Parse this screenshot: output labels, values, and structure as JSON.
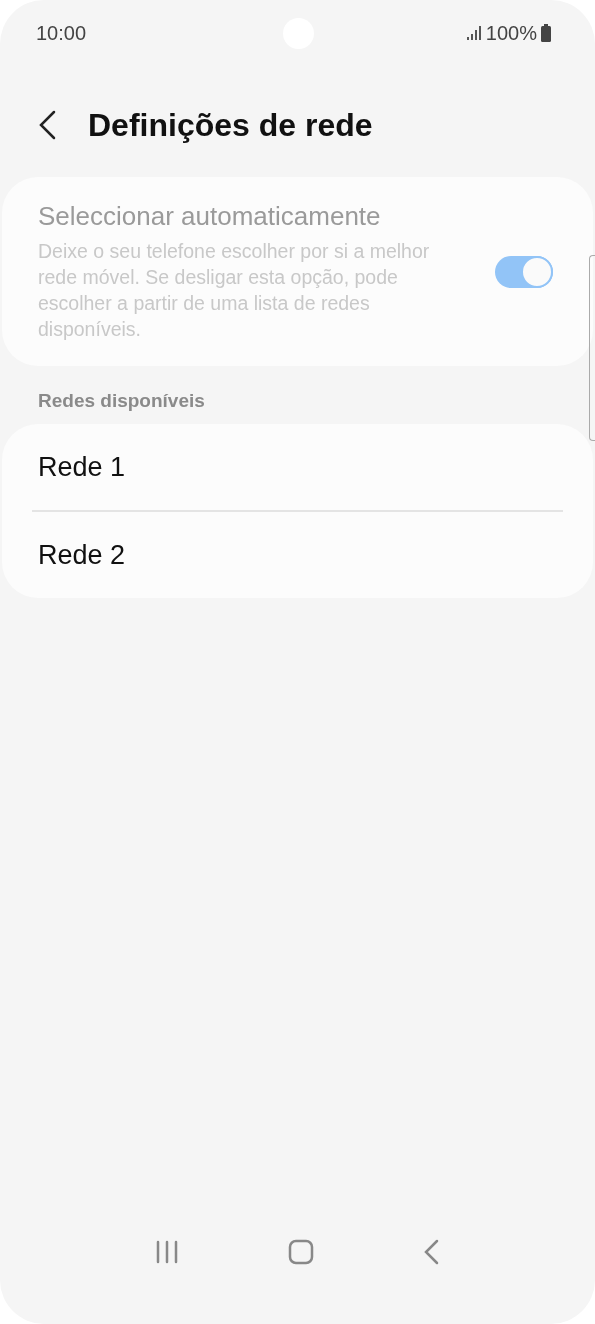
{
  "status_bar": {
    "time": "10:00",
    "battery": "100%"
  },
  "header": {
    "title": "Definições de rede"
  },
  "auto_select": {
    "title": "Seleccionar automaticamente",
    "description": "Deixe o seu telefone escolher por si a melhor rede móvel. Se desligar esta opção, pode escolher a partir de uma lista de redes disponíveis.",
    "on": true,
    "disabled": true
  },
  "section_title": "Redes disponíveis",
  "networks": [
    {
      "name": "Rede 1"
    },
    {
      "name": "Rede 2"
    }
  ]
}
